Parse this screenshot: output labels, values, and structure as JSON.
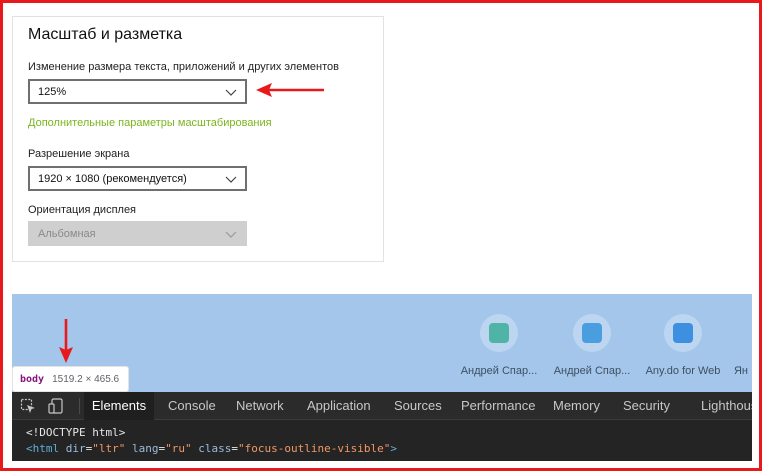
{
  "settings": {
    "title": "Масштаб и разметка",
    "scale_label": "Изменение размера текста, приложений и других элементов",
    "scale_value": "125%",
    "advanced_link": "Дополнительные параметры масштабирования",
    "resolution_label": "Разрешение экрана",
    "resolution_value": "1920 × 1080 (рекомендуется)",
    "orientation_label": "Ориентация дисплея",
    "orientation_value": "Альбомная"
  },
  "browser": {
    "tiles": [
      {
        "label": "Андрей Спар...",
        "color": "#4fb4a6"
      },
      {
        "label": "Андрей Спар...",
        "color": "#4a9ee0"
      },
      {
        "label": "Any.do for Web",
        "color": "#3d8fe0"
      },
      {
        "label": "Ян"
      }
    ]
  },
  "tooltip": {
    "tag": "body",
    "dims": "1519.2 × 465.6"
  },
  "devtools": {
    "tabs": [
      "Elements",
      "Console",
      "Network",
      "Application",
      "Sources",
      "Performance",
      "Memory",
      "Security",
      "Lighthouse"
    ],
    "active_tab": "Elements",
    "code": {
      "doctype": "<!DOCTYPE html>",
      "open": "<",
      "tag": "html",
      "a1": "dir",
      "v1": "\"ltr\"",
      "a2": "lang",
      "v2": "\"ru\"",
      "a3": "class",
      "v3": "\"focus-outline-visible\"",
      "close": ">"
    }
  },
  "colors": {
    "annotation": "#e8191c",
    "link": "#7ab51d",
    "page_bg": "#a3c6ea"
  }
}
